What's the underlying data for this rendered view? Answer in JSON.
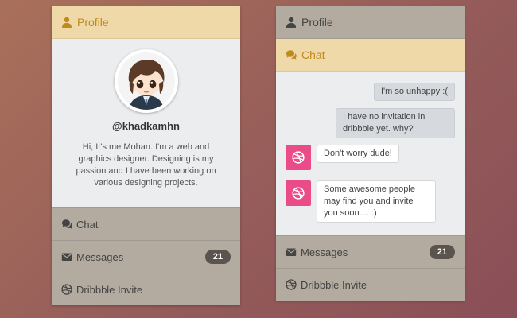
{
  "left_panel": {
    "header_label": "Profile",
    "profile": {
      "username": "@khadkamhn",
      "bio": "Hi, It's me Mohan. I'm a web and graphics designer. Designing is my passion and I have been working on various designing projects."
    },
    "menu": [
      {
        "label": "Chat",
        "icon": "comments-icon"
      },
      {
        "label": "Messages",
        "icon": "envelope-icon",
        "badge": "21"
      },
      {
        "label": "Dribbble Invite",
        "icon": "dribbble-icon"
      }
    ]
  },
  "right_panel": {
    "profile_label": "Profile",
    "chat_label": "Chat",
    "messages": [
      {
        "side": "right",
        "text": "I'm so unhappy :("
      },
      {
        "side": "right",
        "text": "I have no invitation in dribbble yet. why?"
      },
      {
        "side": "left",
        "text": "Don't worry dude!"
      },
      {
        "side": "left",
        "text": "Some awesome people may find you and invite you soon.... :)"
      }
    ],
    "menu": [
      {
        "label": "Messages",
        "icon": "envelope-icon",
        "badge": "21"
      },
      {
        "label": "Dribbble Invite",
        "icon": "dribbble-icon"
      }
    ]
  },
  "colors": {
    "active_header_bg": "#f0d9a9",
    "active_header_text": "#c08a1c",
    "menu_bg": "#b3aba0",
    "dribbble_pink": "#ea4c89",
    "badge_bg": "#5a534e"
  }
}
